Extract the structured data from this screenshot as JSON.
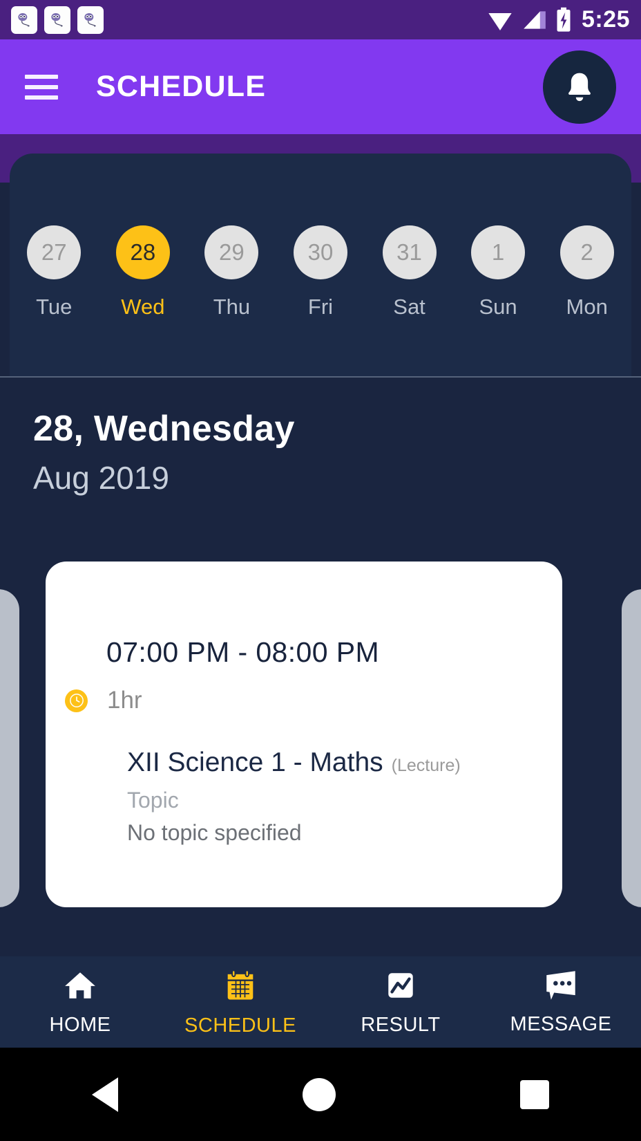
{
  "status_bar": {
    "time": "5:25",
    "notification_icons": [
      "app-notification-icon",
      "app-notification-icon",
      "app-notification-icon"
    ],
    "wifi_icon": "wifi-icon",
    "signal_icon": "cellular-signal-icon",
    "battery_icon": "battery-charging-icon",
    "background_color": "#4a2080"
  },
  "app_bar": {
    "menu_icon": "hamburger-menu-icon",
    "title": "SCHEDULE",
    "notification_icon": "bell-icon",
    "background_color": "#8239f0",
    "title_color": "#ffffff"
  },
  "calendar_strip": {
    "days": [
      {
        "date": "27",
        "dow": "Tue",
        "selected": false
      },
      {
        "date": "28",
        "dow": "Wed",
        "selected": true
      },
      {
        "date": "29",
        "dow": "Thu",
        "selected": false
      },
      {
        "date": "30",
        "dow": "Fri",
        "selected": false
      },
      {
        "date": "31",
        "dow": "Sat",
        "selected": false
      },
      {
        "date": "1",
        "dow": "Sun",
        "selected": false
      },
      {
        "date": "2",
        "dow": "Mon",
        "selected": false
      }
    ],
    "selected_color": "#fdc117",
    "unselected_circle_color": "#e2e2e2",
    "panel_color": "#1c2b48"
  },
  "date_heading": {
    "day_and_weekday": "28, Wednesday",
    "month_year": "Aug 2019"
  },
  "schedule_card": {
    "time_range": "07:00 PM - 08:00 PM",
    "duration_icon": "clock-icon",
    "duration": "1hr",
    "subject": "XII Science 1 - Maths",
    "session_type": "(Lecture)",
    "topic_label": "Topic",
    "topic_value": "No topic specified",
    "card_color": "#ffffff",
    "accent_color": "#fdc117"
  },
  "bottom_nav": {
    "items": [
      {
        "label": "HOME",
        "icon": "home-icon",
        "active": false
      },
      {
        "label": "SCHEDULE",
        "icon": "calendar-icon",
        "active": true
      },
      {
        "label": "RESULT",
        "icon": "result-chart-icon",
        "active": false
      },
      {
        "label": "MESSAGE",
        "icon": "message-bubble-icon",
        "active": false
      }
    ],
    "background_color": "#1c2b48",
    "active_color": "#fdc117"
  },
  "system_nav": {
    "back": "back-triangle-icon",
    "home": "home-circle-icon",
    "recents": "recents-square-icon"
  }
}
